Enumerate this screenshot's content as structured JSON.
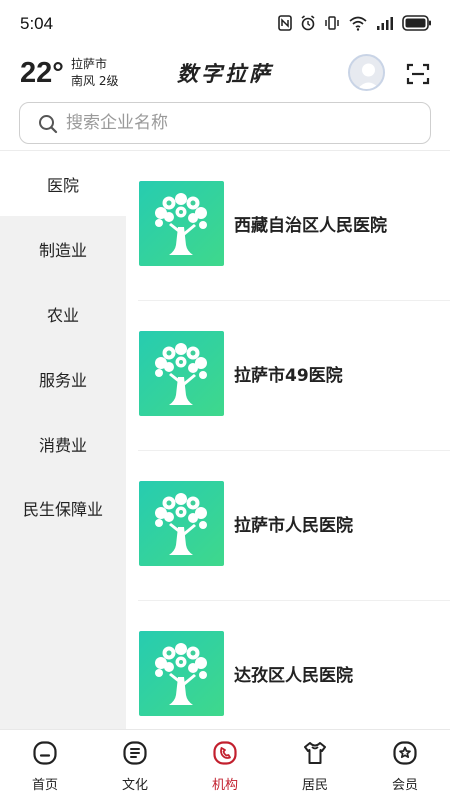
{
  "status_bar": {
    "time": "5:04"
  },
  "header": {
    "temperature": "22°",
    "city": "拉萨市",
    "wind": "南风  2级",
    "app_title": "数字拉萨"
  },
  "search": {
    "placeholder": "搜索企业名称"
  },
  "sidebar": {
    "items": [
      {
        "label": "医院",
        "active": true
      },
      {
        "label": "制造业"
      },
      {
        "label": "农业"
      },
      {
        "label": "服务业"
      },
      {
        "label": "消费业"
      },
      {
        "label": "民生保障业"
      }
    ]
  },
  "organizations": [
    {
      "name": "西藏自治区人民医院"
    },
    {
      "name": "拉萨市49医院"
    },
    {
      "name": "拉萨市人民医院"
    },
    {
      "name": "达孜区人民医院"
    }
  ],
  "bottom_nav": {
    "items": [
      {
        "label": "首页",
        "icon": "home-icon"
      },
      {
        "label": "文化",
        "icon": "culture-icon"
      },
      {
        "label": "机构",
        "icon": "institution-icon",
        "active": true
      },
      {
        "label": "居民",
        "icon": "resident-icon"
      },
      {
        "label": "会员",
        "icon": "member-icon"
      }
    ]
  },
  "colors": {
    "accent": "#c2202e",
    "thumb_start": "#27ccb0",
    "thumb_end": "#3fd88c",
    "sidebar_bg": "#f1f1f1"
  }
}
